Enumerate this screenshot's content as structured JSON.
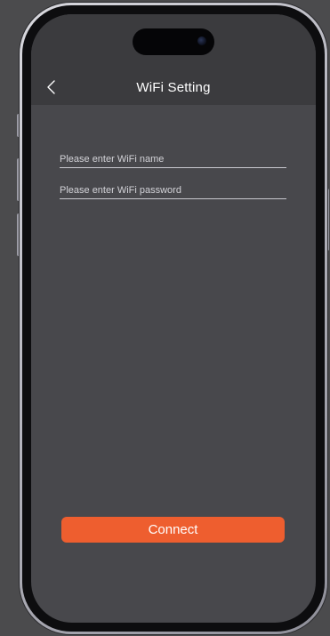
{
  "header": {
    "title": "WiFi Setting",
    "back_icon": "chevron-left-icon"
  },
  "form": {
    "wifi_name": {
      "value": "",
      "placeholder": "Please enter WiFi name"
    },
    "wifi_password": {
      "value": "",
      "placeholder": "Please enter WiFi password"
    }
  },
  "actions": {
    "connect_label": "Connect"
  },
  "colors": {
    "accent": "#EE5E2F",
    "screen_background": "#48484C",
    "nav_background": "#3B3B3E",
    "text_primary": "#FFFFFF"
  }
}
